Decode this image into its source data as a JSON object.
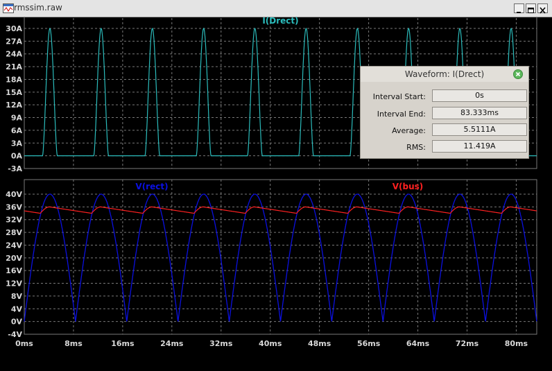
{
  "window": {
    "title": "rmssim.raw",
    "buttons": {
      "minimize": "minimize-icon",
      "maximize": "maximize-icon",
      "close": "close-icon"
    }
  },
  "colors": {
    "background": "#000000",
    "grid": "#7a7a7a",
    "axis_text": "#d8d8d8",
    "drect": "#2bbcbc",
    "vrect": "#0b10e0",
    "vbus": "#ff2020"
  },
  "dialog": {
    "title": "Waveform: I(Drect)",
    "rows": [
      {
        "label": "Interval Start:",
        "value": "0s"
      },
      {
        "label": "Interval End:",
        "value": "83.333ms"
      },
      {
        "label": "Average:",
        "value": "5.5111A"
      },
      {
        "label": "RMS:",
        "value": "11.419A"
      }
    ]
  },
  "chart_data": [
    {
      "type": "line",
      "title": "",
      "series": [
        {
          "name": "I(Drect)",
          "color": "#2bbcbc"
        }
      ],
      "xlim": [
        0,
        83.333
      ],
      "xunit": "ms",
      "ylim": [
        -3,
        30
      ],
      "yticks": [
        "30A",
        "27A",
        "24A",
        "21A",
        "18A",
        "15A",
        "12A",
        "9A",
        "6A",
        "3A",
        "0A",
        "-3A"
      ],
      "ytick_values": [
        30,
        27,
        24,
        21,
        18,
        15,
        12,
        9,
        6,
        3,
        0,
        -3
      ],
      "grid": true,
      "pulses": {
        "period_ms": 8.333,
        "peak_A": 30,
        "peak_times_ms": [
          4.17,
          12.5,
          20.83,
          29.17,
          37.5,
          45.83,
          54.17,
          62.5,
          70.83,
          79.17
        ],
        "conduction_halfwidth_ms": 1.2
      }
    },
    {
      "type": "line",
      "title": "",
      "series": [
        {
          "name": "V(rect)",
          "color": "#0b10e0",
          "peak_V": 40,
          "min_V": 0,
          "period_ms": 8.333
        },
        {
          "name": "V(bus)",
          "color": "#ff2020",
          "max_V": 36,
          "min_V": 34,
          "period_ms": 8.333
        }
      ],
      "xlim": [
        0,
        83.333
      ],
      "ylim": [
        -4,
        40
      ],
      "yticks": [
        "40V",
        "36V",
        "32V",
        "28V",
        "24V",
        "20V",
        "16V",
        "12V",
        "8V",
        "4V",
        "0V",
        "-4V"
      ],
      "ytick_values": [
        40,
        36,
        32,
        28,
        24,
        20,
        16,
        12,
        8,
        4,
        0,
        -4
      ],
      "xticks": [
        "0ms",
        "8ms",
        "16ms",
        "24ms",
        "32ms",
        "40ms",
        "48ms",
        "56ms",
        "64ms",
        "72ms",
        "80ms"
      ],
      "xtick_values": [
        0,
        8,
        16,
        24,
        32,
        40,
        48,
        56,
        64,
        72,
        80
      ],
      "grid": true
    }
  ]
}
